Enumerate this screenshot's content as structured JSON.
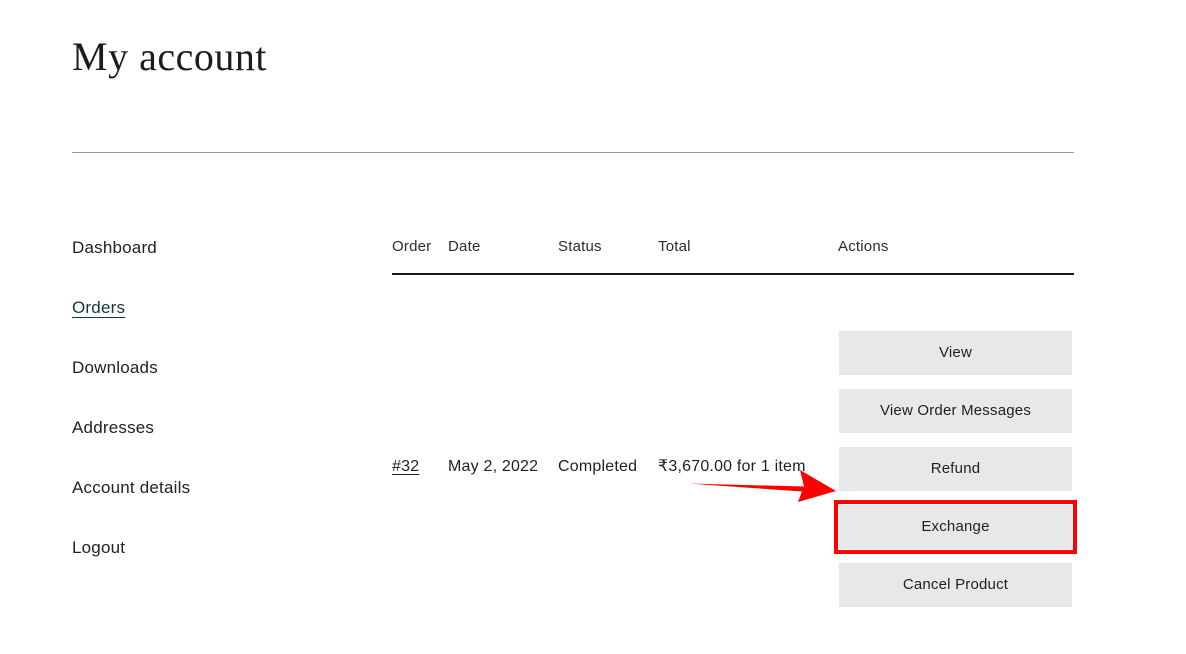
{
  "page": {
    "title": "My account"
  },
  "account_nav": {
    "items": [
      {
        "label": "Dashboard",
        "active": false
      },
      {
        "label": "Orders",
        "active": true
      },
      {
        "label": "Downloads",
        "active": false
      },
      {
        "label": "Addresses",
        "active": false
      },
      {
        "label": "Account details",
        "active": false
      },
      {
        "label": "Logout",
        "active": false
      }
    ]
  },
  "orders_table": {
    "columns": {
      "order": "Order",
      "date": "Date",
      "status": "Status",
      "total": "Total",
      "actions": "Actions"
    },
    "rows": [
      {
        "order": "#32",
        "date": "May 2, 2022",
        "status": "Completed",
        "total": "₹3,670.00 for 1 item",
        "actions": [
          {
            "label": "View",
            "highlighted": false
          },
          {
            "label": "View Order Messages",
            "highlighted": false
          },
          {
            "label": "Refund",
            "highlighted": false
          },
          {
            "label": "Exchange",
            "highlighted": true
          },
          {
            "label": "Cancel Product",
            "highlighted": false
          }
        ]
      }
    ]
  },
  "annotation": {
    "arrow_color": "#ff0000",
    "highlight_color": "#ff0000",
    "points_to": "Exchange"
  },
  "colors": {
    "button_background": "#e8e8ea",
    "text": "#1f1f1f",
    "active_link": "#14383a",
    "divider": "#9a9a9a",
    "header_rule": "#1a1a1a"
  }
}
